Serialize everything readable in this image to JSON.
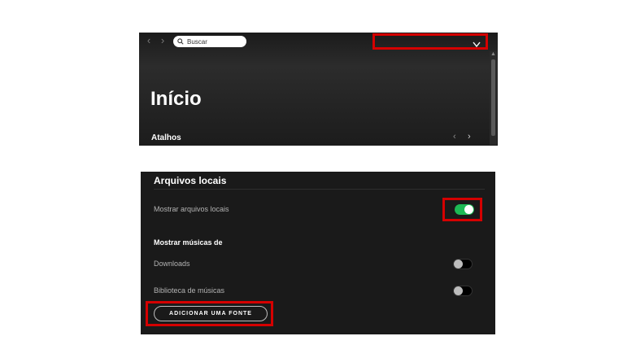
{
  "header": {
    "search_placeholder": "Buscar",
    "user_menu_label": ""
  },
  "home": {
    "title": "Início",
    "shortcuts_label": "Atalhos"
  },
  "settings": {
    "section_title": "Arquivos locais",
    "show_local_files_label": "Mostrar arquivos locais",
    "show_local_files_on": true,
    "show_songs_from_label": "Mostrar músicas de",
    "sources": [
      {
        "label": "Downloads",
        "on": false
      },
      {
        "label": "Biblioteca de músicas",
        "on": false
      }
    ],
    "add_source_label": "ADICIONAR UMA FONTE"
  },
  "colors": {
    "accent": "#1db954",
    "highlight": "#d50000"
  },
  "icons": [
    "chevron-left-icon",
    "chevron-right-icon",
    "search-icon",
    "chevron-down-icon"
  ]
}
